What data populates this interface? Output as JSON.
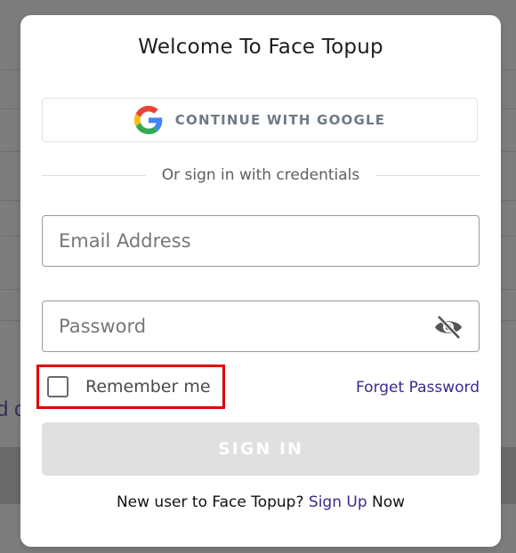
{
  "modal": {
    "title": "Welcome To Face Topup"
  },
  "google_button": {
    "label": "CONTINUE WITH GOOGLE",
    "icon": "google-logo-icon"
  },
  "divider": {
    "text": "Or sign in with credentials"
  },
  "email_field": {
    "placeholder": "Email Address",
    "value": ""
  },
  "password_field": {
    "placeholder": "Password",
    "value": "",
    "toggle_icon": "eye-slash-icon"
  },
  "remember_me": {
    "label": "Remember me",
    "checked": false
  },
  "forget_password": {
    "label": "Forget Password"
  },
  "sign_in_button": {
    "label": "SIGN IN"
  },
  "signup": {
    "prefix": "New user to Face Topup?",
    "link": "Sign Up",
    "suffix": "Now"
  },
  "background": {
    "fragment_text": "d c"
  },
  "colors": {
    "accent": "#3b2a8c",
    "highlight_border": "#e00000",
    "disabled_button": "#e0e0e0"
  }
}
